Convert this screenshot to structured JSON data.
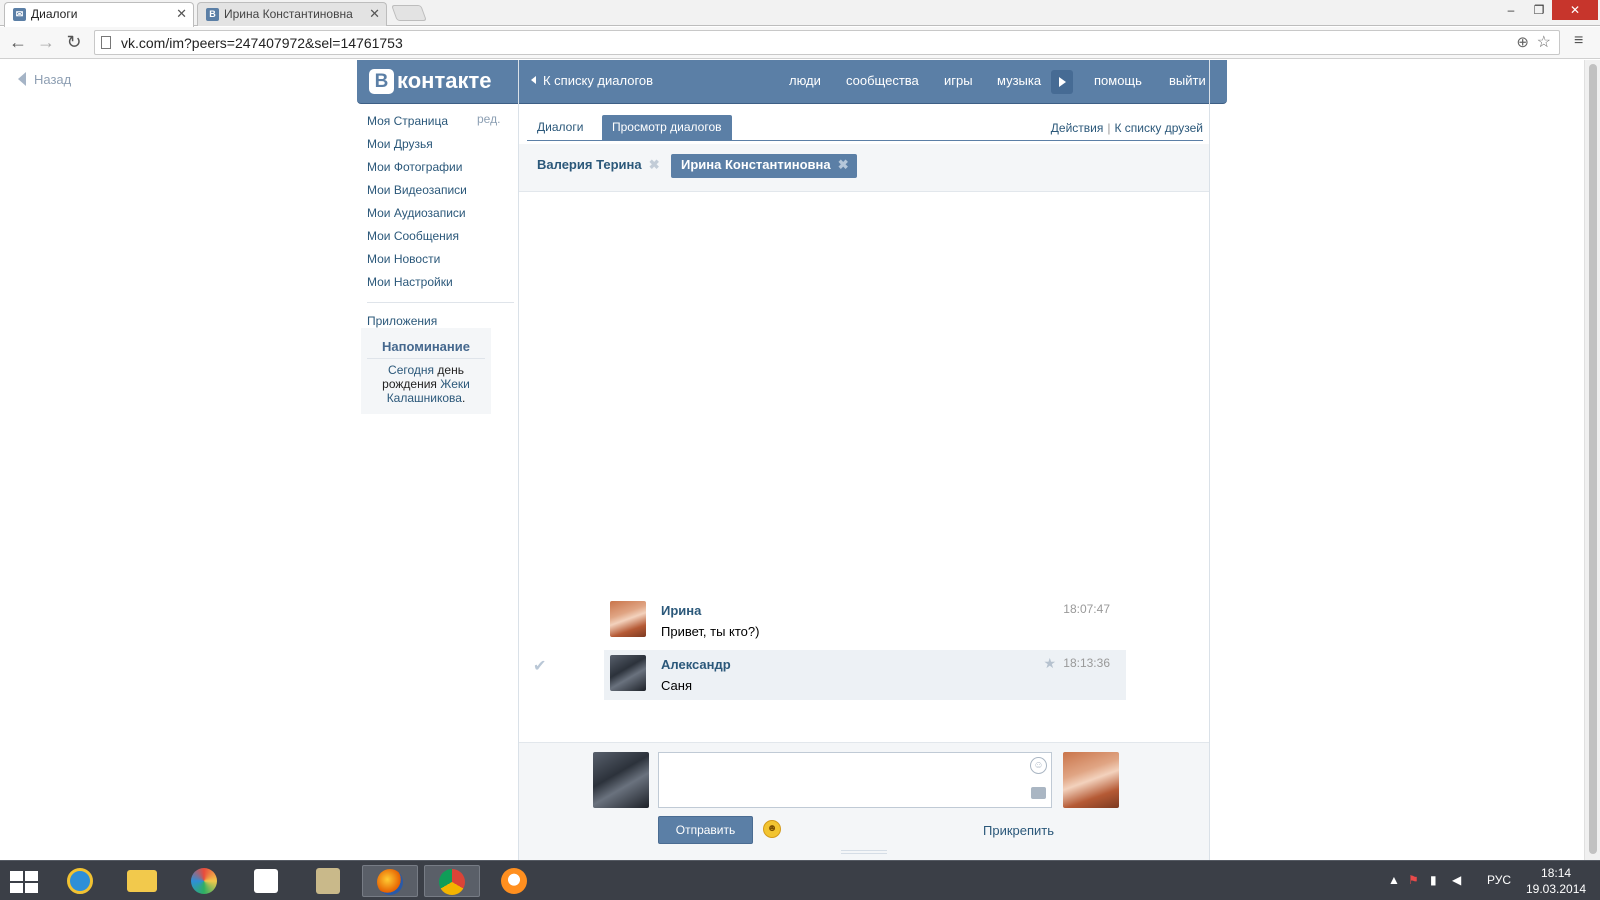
{
  "browser": {
    "tabs": [
      {
        "title": "Диалоги",
        "favicon": "message-icon",
        "active": true
      },
      {
        "title": "Ирина Константиновна",
        "favicon": "vk-icon",
        "active": false
      }
    ],
    "url": "vk.com/im?peers=247407972&sel=14761753"
  },
  "page": {
    "back_label": "Назад"
  },
  "vk": {
    "logo_letter": "В",
    "logo_text": "контакте",
    "back_to_list": "К списку диалогов",
    "nav": [
      "люди",
      "сообщества",
      "игры",
      "музыка",
      "помощь",
      "выйти"
    ],
    "sidebar": {
      "items": [
        "Моя Страница",
        "Мои Друзья",
        "Мои Фотографии",
        "Мои Видеозаписи",
        "Мои Аудиозаписи",
        "Мои Сообщения",
        "Мои Новости",
        "Мои Настройки"
      ],
      "edit": "ред.",
      "apps": "Приложения"
    },
    "reminder": {
      "title": "Напоминание",
      "part1": "Сегодня",
      "part2": "день рождения",
      "part3": "Жеки Калашникова",
      "part4": "."
    },
    "tabs": {
      "dialogs": "Диалоги",
      "view": "Просмотр диалогов",
      "actions": "Действия",
      "friends": "К списку друзей"
    },
    "peers": [
      {
        "name": "Валерия Терина",
        "selected": false
      },
      {
        "name": "Ирина Константиновна",
        "selected": true
      }
    ],
    "messages": [
      {
        "author": "Ирина",
        "text": "Привет, ты кто?)",
        "time": "18:07:47"
      },
      {
        "author": "Александр",
        "text": "Саня",
        "time": "18:13:36"
      }
    ],
    "composer": {
      "send": "Отправить",
      "attach": "Прикрепить"
    }
  },
  "taskbar": {
    "lang": "РУС",
    "time": "18:14",
    "date": "19.03.2014"
  },
  "colors": {
    "vk_blue": "#5b7fa6",
    "link": "#2b587a",
    "taskbar": "#3b3f47"
  }
}
